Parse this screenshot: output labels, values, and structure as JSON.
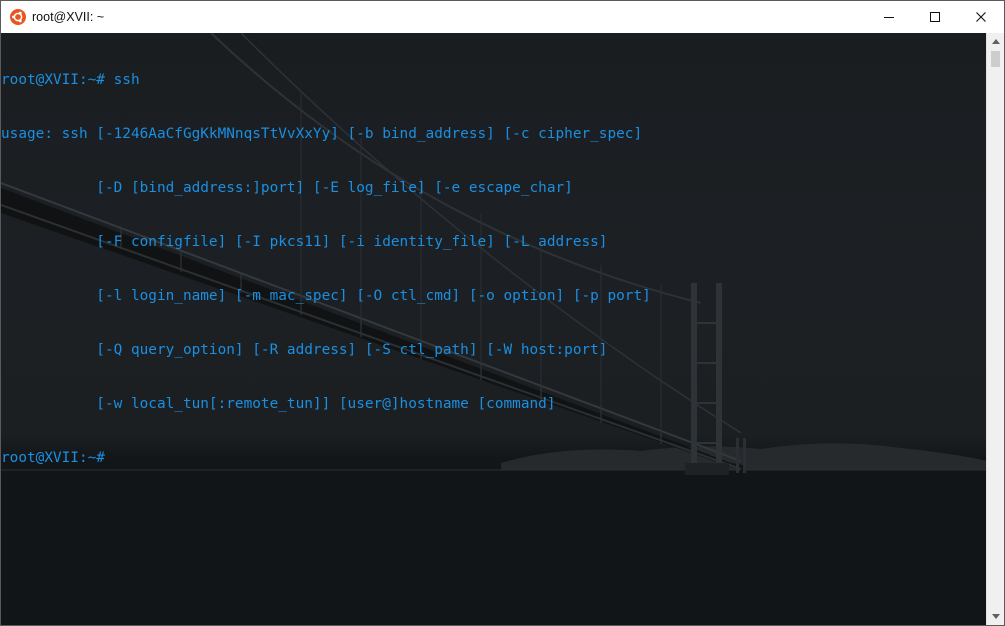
{
  "window": {
    "title": "root@XVII: ~"
  },
  "terminal": {
    "lines": [
      "root@XVII:~# ssh",
      "usage: ssh [-1246AaCfGgKkMNnqsTtVvXxYy] [-b bind_address] [-c cipher_spec]",
      "           [-D [bind_address:]port] [-E log_file] [-e escape_char]",
      "           [-F configfile] [-I pkcs11] [-i identity_file] [-L address]",
      "           [-l login_name] [-m mac_spec] [-O ctl_cmd] [-o option] [-p port]",
      "           [-Q query_option] [-R address] [-S ctl_path] [-W host:port]",
      "           [-w local_tun[:remote_tun]] [user@]hostname [command]",
      "root@XVII:~#"
    ],
    "text_color": "#1b8fe0"
  },
  "icons": {
    "app": "ubuntu-logo-icon",
    "minimize": "minimize-icon",
    "maximize": "maximize-icon",
    "close": "close-icon",
    "scroll_up": "scroll-up-arrow-icon",
    "scroll_down": "scroll-down-arrow-icon"
  }
}
